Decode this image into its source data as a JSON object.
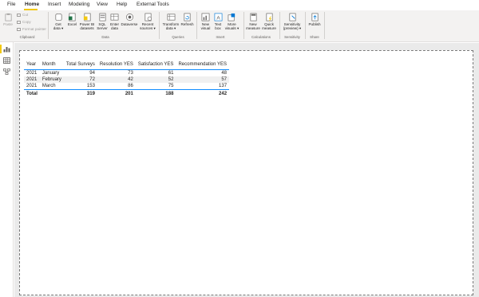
{
  "menu": {
    "items": [
      {
        "label": "File"
      },
      {
        "label": "Home"
      },
      {
        "label": "Insert"
      },
      {
        "label": "Modeling"
      },
      {
        "label": "View"
      },
      {
        "label": "Help"
      },
      {
        "label": "External Tools"
      }
    ],
    "active": "Home"
  },
  "ribbon": {
    "clipboard": {
      "paste": "Paste",
      "cut": "Cut",
      "copy": "Copy",
      "format_painter": "Format painter",
      "group": "Clipboard"
    },
    "data": {
      "get_data": "Get\ndata ▾",
      "excel": "Excel",
      "power_bi_datasets": "Power BI\ndatasets",
      "sql_server": "SQL\nServer",
      "enter_data": "Enter\ndata",
      "dataverse": "Dataverse",
      "recent_sources": "Recent\nsources ▾",
      "group": "Data"
    },
    "queries": {
      "transform_data": "Transform\ndata ▾",
      "refresh": "Refresh",
      "group": "Queries"
    },
    "insert": {
      "new_visual": "New\nvisual",
      "text_box": "Text\nbox",
      "more_visuals": "More\nvisuals ▾",
      "group": "Insert"
    },
    "calculations": {
      "new_measure": "New\nmeasure",
      "quick_measure": "Quick\nmeasure",
      "group": "Calculations"
    },
    "sensitivity": {
      "sensitivity": "Sensitivity\n(preview) ▾",
      "group": "Sensitivity"
    },
    "share": {
      "publish": "Publish",
      "group": "Share"
    }
  },
  "table": {
    "columns": [
      "Year",
      "Month",
      "Total Surveys",
      "Resolution YES",
      "Satisfaction YES",
      "Recommendation YES"
    ],
    "rows": [
      [
        "2021",
        "January",
        "94",
        "73",
        "61",
        "48"
      ],
      [
        "2021",
        "February",
        "72",
        "42",
        "52",
        "57"
      ],
      [
        "2021",
        "March",
        "153",
        "86",
        "75",
        "137"
      ]
    ],
    "total": [
      "Total",
      "",
      "319",
      "201",
      "188",
      "242"
    ]
  },
  "colors": {
    "accent": "#f2c811",
    "table_line": "#118dff",
    "ribbon_bg": "#f3f2f1",
    "canvas_bg": "#eaeaea"
  }
}
